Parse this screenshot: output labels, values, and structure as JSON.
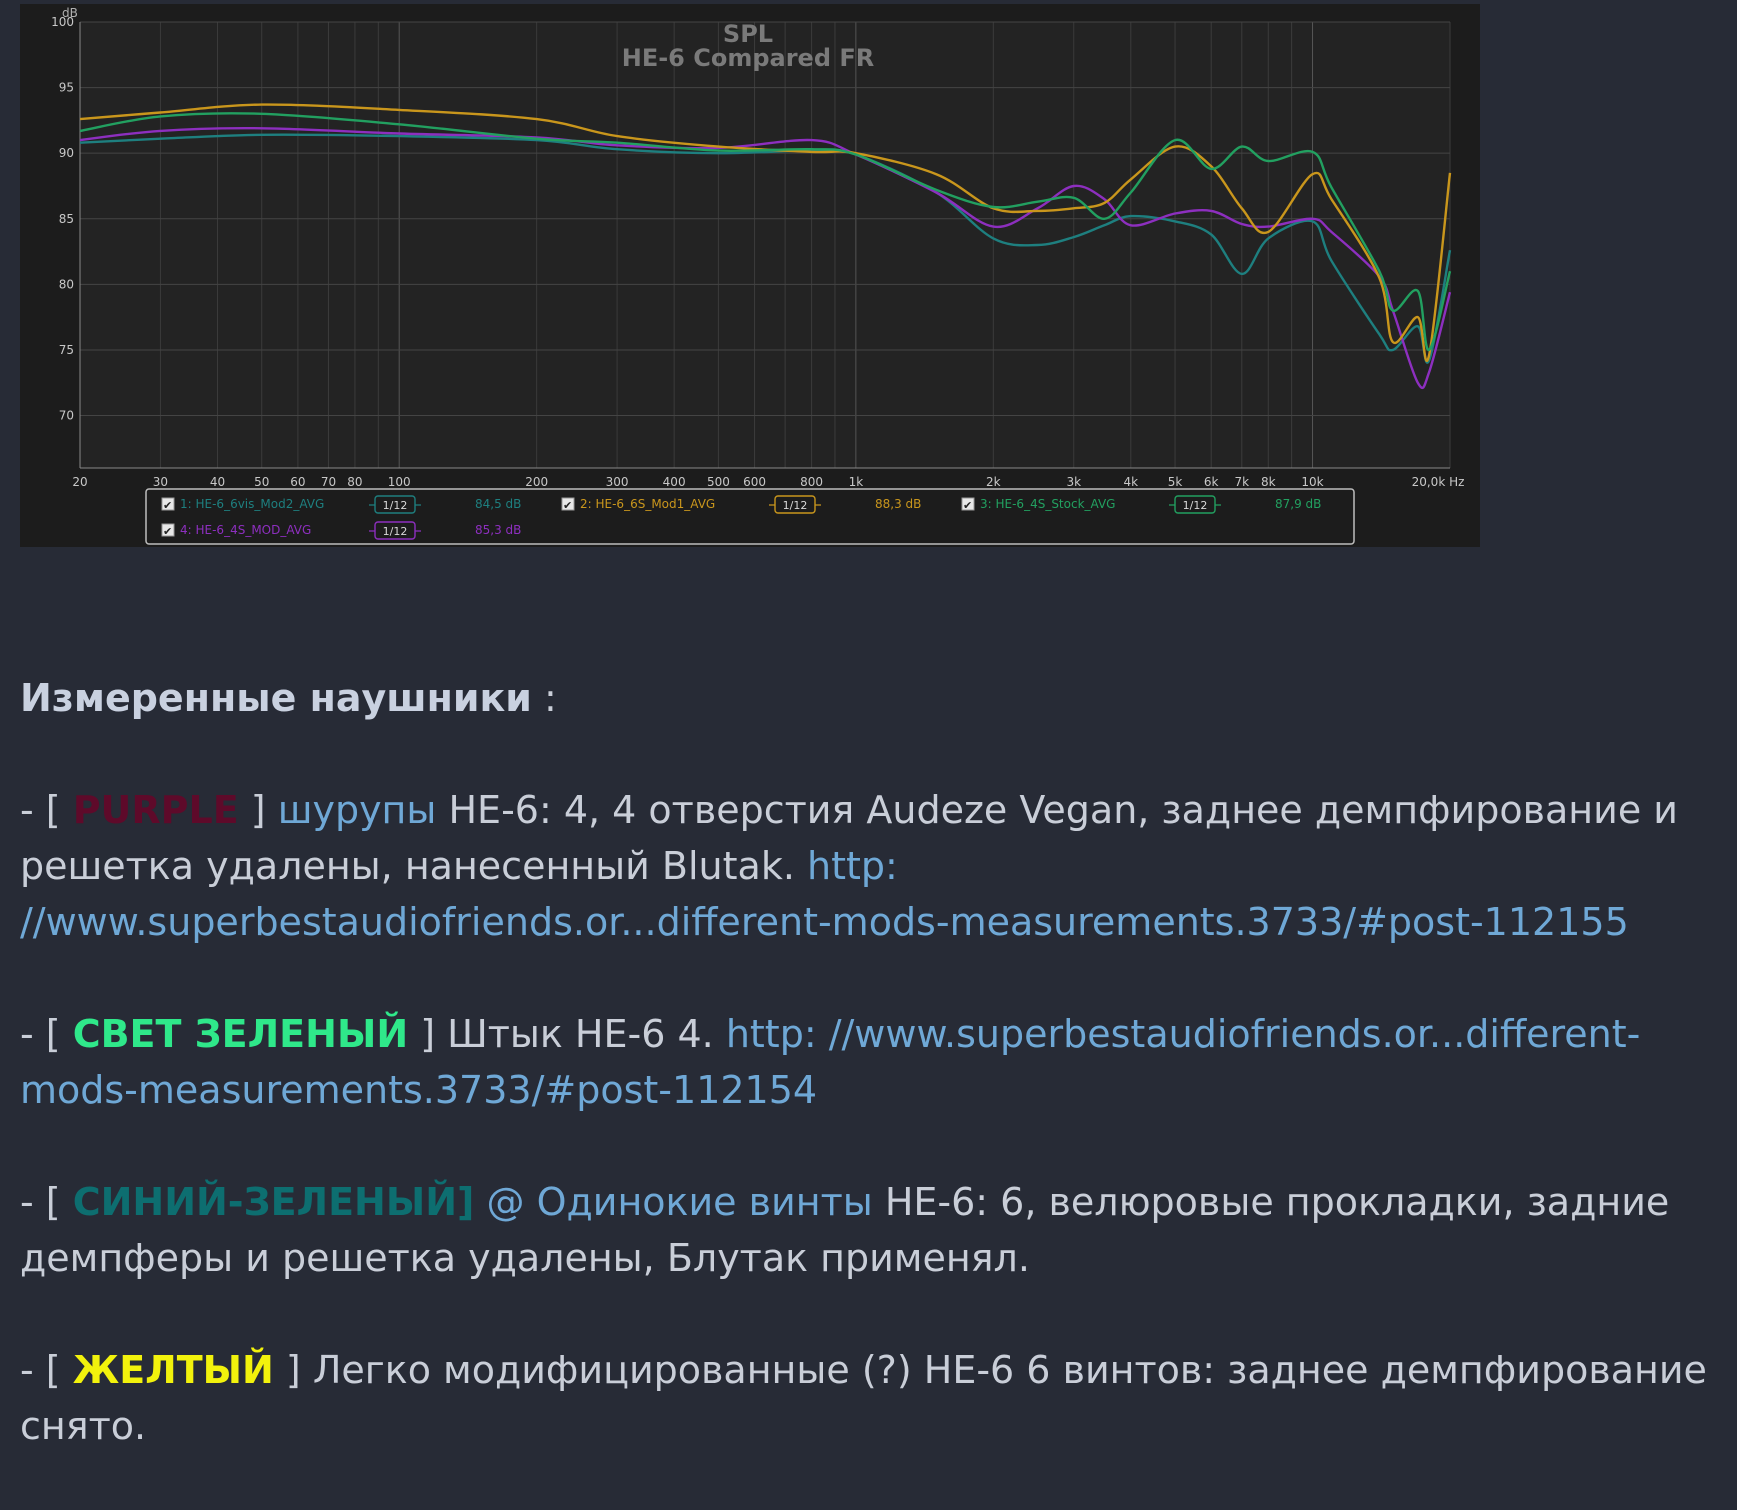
{
  "chart_data": {
    "type": "line",
    "title": "SPL",
    "subtitle": "HE-6 Compared FR",
    "ylabel": "dB",
    "xunit": "Hz",
    "xscale": "log",
    "xlim": [
      20,
      20000
    ],
    "ylim": [
      66,
      100
    ],
    "yticks": [
      70,
      75,
      80,
      85,
      90,
      95,
      100
    ],
    "xticks": [
      20,
      30,
      40,
      50,
      60,
      70,
      80,
      100,
      200,
      300,
      400,
      500,
      600,
      800,
      1000,
      2000,
      3000,
      4000,
      5000,
      6000,
      7000,
      8000,
      10000,
      20000
    ],
    "xtick_labels": [
      "20",
      "30",
      "40",
      "50",
      "60",
      "70",
      "80",
      "100",
      "200",
      "300",
      "400",
      "500",
      "600",
      "800",
      "1k",
      "2k",
      "3k",
      "4k",
      "5k",
      "6k",
      "7k",
      "8k",
      "10k",
      "20,0k Hz"
    ],
    "grid": true,
    "legend_position": "bottom",
    "smoothing_label": "1/12",
    "series": [
      {
        "name": "1: HE-6_6vis_Mod2_AVG",
        "legend_value": "84,5 dB",
        "color": "#1e7f7f",
        "points": [
          [
            20,
            90.8
          ],
          [
            30,
            91.1
          ],
          [
            50,
            91.4
          ],
          [
            100,
            91.3
          ],
          [
            200,
            91.0
          ],
          [
            300,
            90.3
          ],
          [
            500,
            90.0
          ],
          [
            800,
            90.2
          ],
          [
            1000,
            89.9
          ],
          [
            1500,
            87.0
          ],
          [
            2000,
            83.5
          ],
          [
            2500,
            83.0
          ],
          [
            3000,
            83.6
          ],
          [
            3500,
            84.5
          ],
          [
            4000,
            85.2
          ],
          [
            5000,
            84.8
          ],
          [
            6000,
            83.8
          ],
          [
            7000,
            80.8
          ],
          [
            8000,
            83.5
          ],
          [
            10000,
            84.8
          ],
          [
            11000,
            81.8
          ],
          [
            14000,
            76.2
          ],
          [
            15000,
            75.0
          ],
          [
            17000,
            76.8
          ],
          [
            18000,
            74.2
          ],
          [
            20000,
            82.6
          ]
        ]
      },
      {
        "name": "2: HE-6_6S_Mod1_AVG",
        "legend_value": "88,3 dB",
        "color": "#c9961c",
        "points": [
          [
            20,
            92.6
          ],
          [
            30,
            93.1
          ],
          [
            50,
            93.7
          ],
          [
            100,
            93.3
          ],
          [
            200,
            92.6
          ],
          [
            300,
            91.3
          ],
          [
            500,
            90.5
          ],
          [
            800,
            90.1
          ],
          [
            1000,
            90.0
          ],
          [
            1500,
            88.4
          ],
          [
            2000,
            85.8
          ],
          [
            2500,
            85.6
          ],
          [
            3000,
            85.8
          ],
          [
            3500,
            86.2
          ],
          [
            4000,
            88.0
          ],
          [
            5000,
            90.5
          ],
          [
            6000,
            89.0
          ],
          [
            7000,
            85.8
          ],
          [
            8000,
            84.0
          ],
          [
            10000,
            88.4
          ],
          [
            11000,
            86.5
          ],
          [
            14000,
            80.5
          ],
          [
            15000,
            75.6
          ],
          [
            17000,
            77.5
          ],
          [
            18000,
            74.6
          ],
          [
            20000,
            88.5
          ]
        ]
      },
      {
        "name": "3: HE-6_4S_Stock_AVG",
        "legend_value": "87,9 dB",
        "color": "#22a060",
        "points": [
          [
            20,
            91.7
          ],
          [
            30,
            92.8
          ],
          [
            50,
            93.0
          ],
          [
            100,
            92.2
          ],
          [
            200,
            91.1
          ],
          [
            300,
            90.8
          ],
          [
            500,
            90.2
          ],
          [
            800,
            90.3
          ],
          [
            1000,
            89.9
          ],
          [
            1500,
            87.2
          ],
          [
            2000,
            85.9
          ],
          [
            2500,
            86.3
          ],
          [
            3000,
            86.6
          ],
          [
            3500,
            85.0
          ],
          [
            4000,
            87.0
          ],
          [
            5000,
            91.0
          ],
          [
            6000,
            88.8
          ],
          [
            7000,
            90.5
          ],
          [
            8000,
            89.4
          ],
          [
            10000,
            90.1
          ],
          [
            11000,
            87.4
          ],
          [
            14000,
            81.0
          ],
          [
            15000,
            78.0
          ],
          [
            17000,
            79.5
          ],
          [
            18000,
            75.0
          ],
          [
            20000,
            81.0
          ]
        ]
      },
      {
        "name": "4: HE-6_4S_MOD_AVG",
        "legend_value": "85,3 dB",
        "color": "#8d2fbf",
        "points": [
          [
            20,
            91.0
          ],
          [
            30,
            91.7
          ],
          [
            50,
            91.9
          ],
          [
            100,
            91.5
          ],
          [
            200,
            91.2
          ],
          [
            300,
            90.6
          ],
          [
            500,
            90.4
          ],
          [
            800,
            91.0
          ],
          [
            1000,
            89.9
          ],
          [
            1500,
            87.0
          ],
          [
            2000,
            84.4
          ],
          [
            2500,
            85.8
          ],
          [
            3000,
            87.5
          ],
          [
            3500,
            86.5
          ],
          [
            4000,
            84.5
          ],
          [
            5000,
            85.4
          ],
          [
            6000,
            85.6
          ],
          [
            7000,
            84.6
          ],
          [
            8000,
            84.4
          ],
          [
            10000,
            85.0
          ],
          [
            11000,
            84.0
          ],
          [
            14000,
            80.6
          ],
          [
            15000,
            78.0
          ],
          [
            17000,
            72.5
          ],
          [
            18000,
            73.3
          ],
          [
            20000,
            79.4
          ]
        ]
      }
    ]
  },
  "post": {
    "heading": "Измеренные наушники",
    "heading_suffix": " :",
    "items": [
      {
        "prefix": "- [ ",
        "tag": "PURPLE",
        "tag_color": "#5e0a2a",
        "after_tag": " ] ",
        "link_label": "шурупы",
        "text": " HE-6: 4, 4 отверстия Audeze Vegan, заднее демпфирование и решетка удалены, нанесенный Blutak. ",
        "url": "http: //www.superbestaudiofriends.or...different-mods-measurements.3733/#post-112155"
      },
      {
        "prefix": "- [ ",
        "tag": "СВЕТ ЗЕЛЕНЫЙ",
        "tag_color": "#2fe88a",
        "after_tag": " ] ",
        "text": "Штык HE-6 4. ",
        "url": "http: //www.superbestaudiofriends.or...different-mods-measurements.3733/#post-112154"
      },
      {
        "prefix": "- [ ",
        "tag": "СИНИЙ-ЗЕЛЕНЫЙ]",
        "tag_color": "#0d6e70",
        "link_label": " @ Одинокие винты",
        "text": " HE-6: 6, велюровые прокладки, задние демпферы и решетка удалены, Блутак применял."
      },
      {
        "prefix": "- [ ",
        "tag": "ЖЕЛТЫЙ",
        "tag_color": "#f2f20c",
        "after_tag": " ] ",
        "text": "Легко модифицированные (?) HE-6 6 винтов: заднее демпфирование снято."
      }
    ]
  }
}
